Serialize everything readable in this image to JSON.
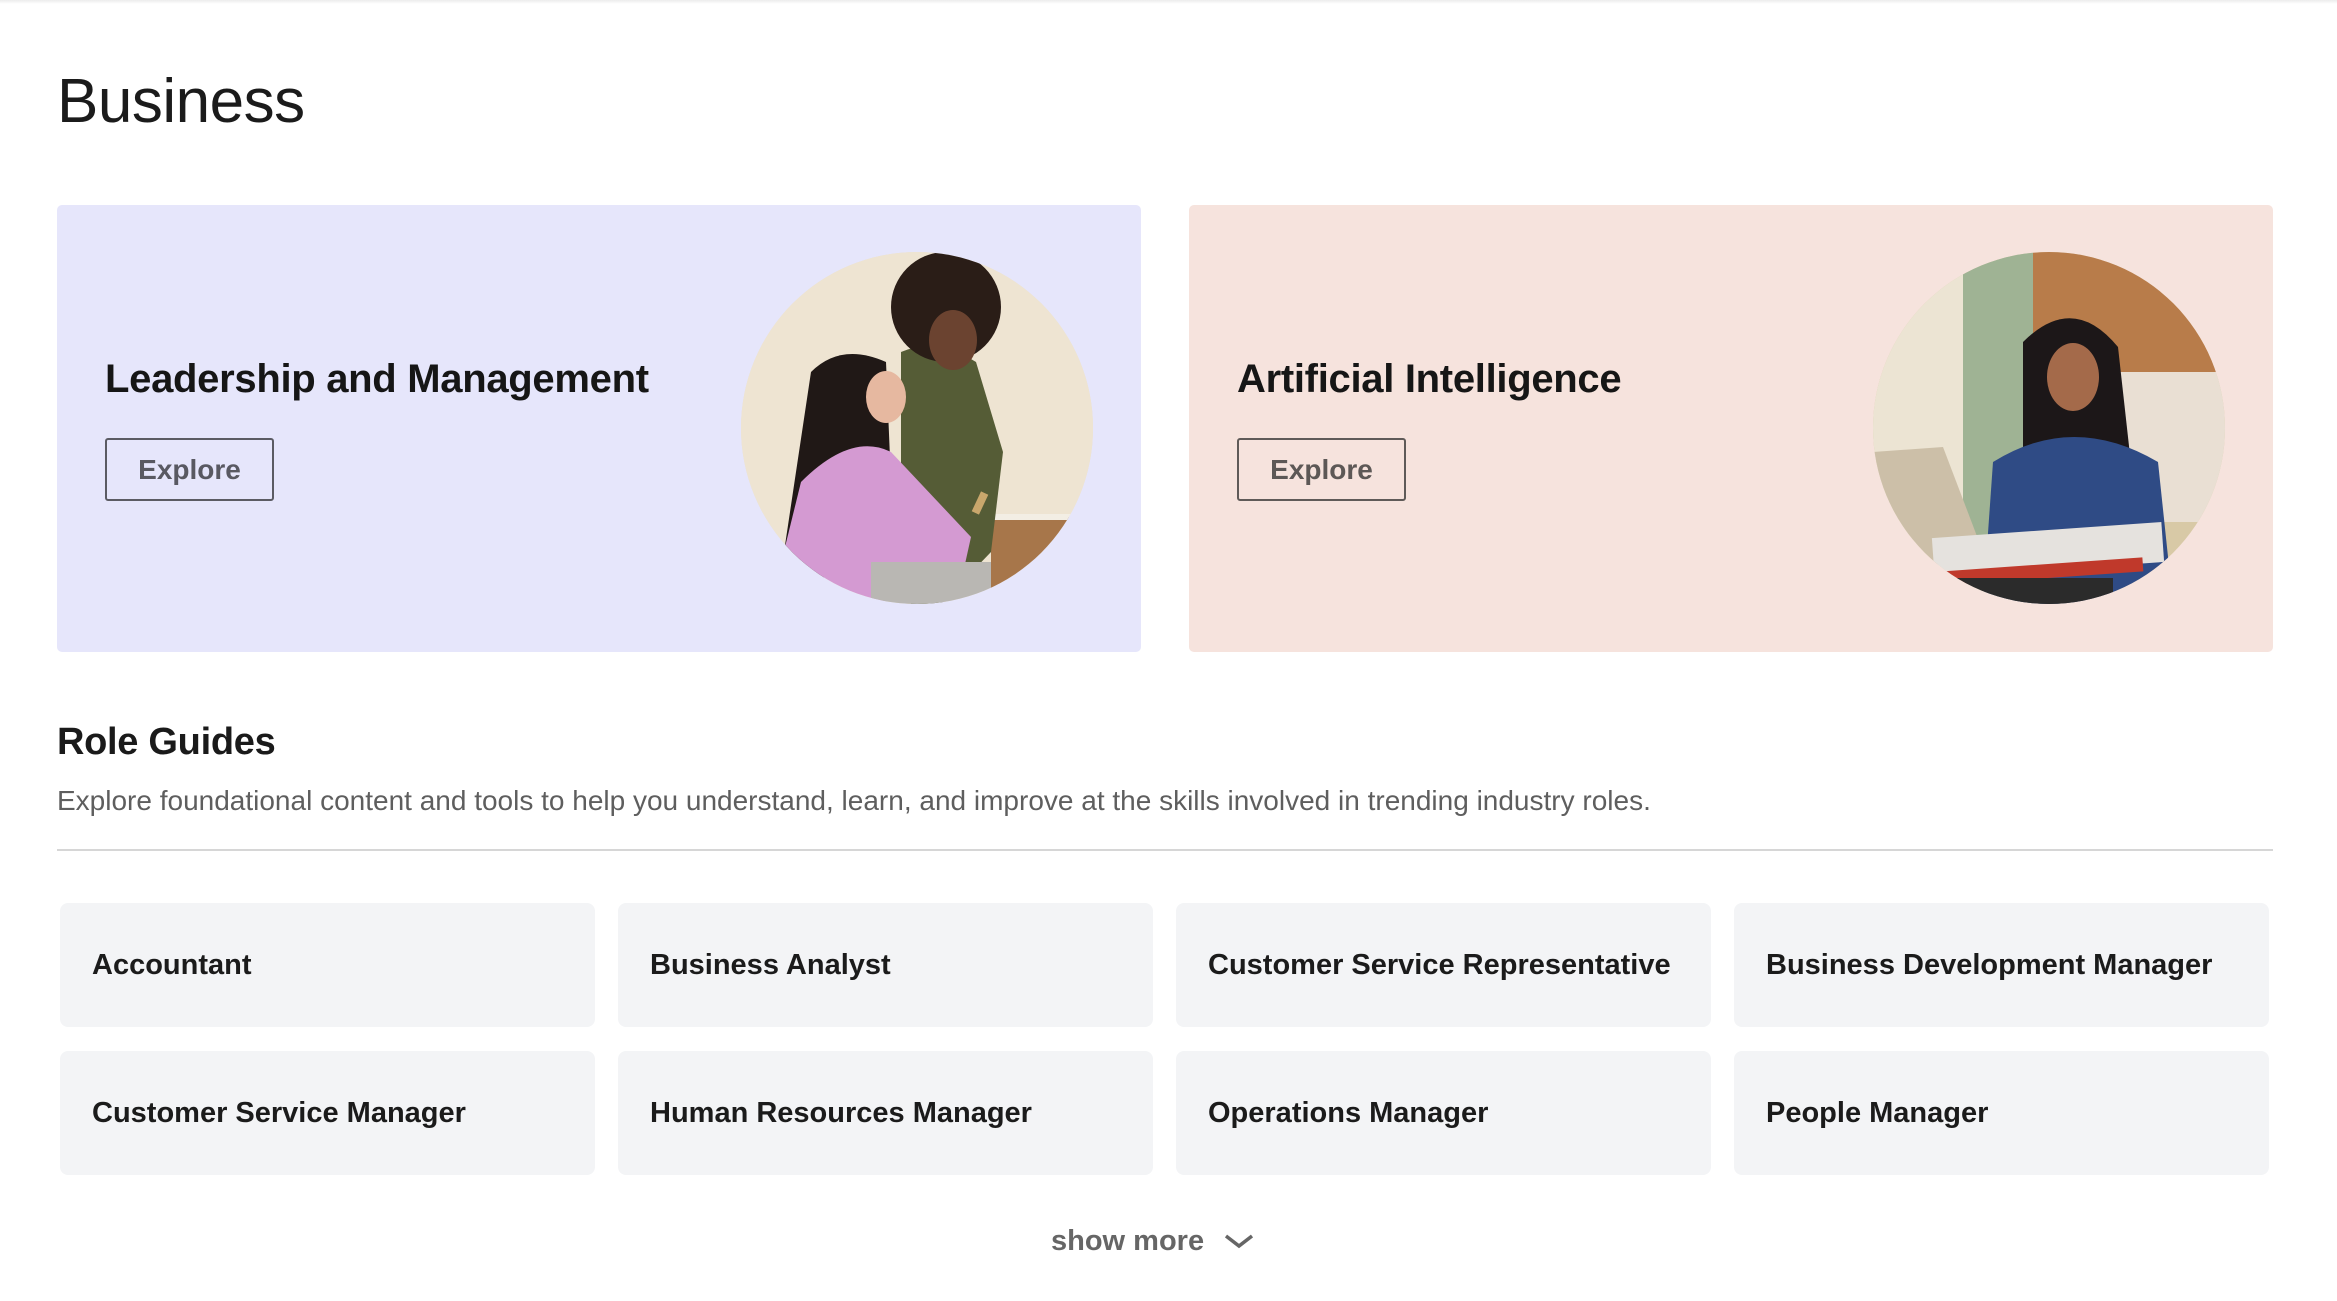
{
  "page": {
    "title": "Business"
  },
  "hero_cards": [
    {
      "title": "Leadership and Management",
      "button_label": "Explore",
      "background_color": "#e6e6fb",
      "image_description": "Two women looking at a phone at a desk"
    },
    {
      "title": "Artificial Intelligence",
      "button_label": "Explore",
      "background_color": "#f6e3dd",
      "image_description": "Woman in blue blouse working on a laptop"
    }
  ],
  "role_guides": {
    "title": "Role Guides",
    "description": "Explore foundational content and tools to help you understand, learn, and improve at the skills involved in trending industry roles.",
    "roles": [
      "Accountant",
      "Business Analyst",
      "Customer Service Representative",
      "Business Development Manager",
      "Customer Service Manager",
      "Human Resources Manager",
      "Operations Manager",
      "People Manager"
    ],
    "show_more_label": "show more",
    "show_more_icon": "chevron-down-icon"
  }
}
